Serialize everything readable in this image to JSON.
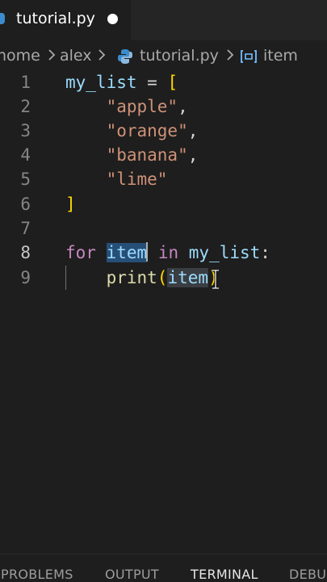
{
  "tab": {
    "filename": "tutorial.py"
  },
  "breadcrumb": {
    "items": [
      "home",
      "alex",
      "tutorial.py",
      "item"
    ]
  },
  "editor": {
    "line_numbers": [
      "1",
      "2",
      "3",
      "4",
      "5",
      "6",
      "7",
      "8",
      "9"
    ],
    "active_line": "8",
    "tokens": {
      "my_list": "my_list",
      "eq": " = ",
      "open_bracket": "[",
      "close_bracket": "]",
      "apple": "\"apple\"",
      "orange": "\"orange\"",
      "banana": "\"banana\"",
      "lime": "\"lime\"",
      "comma": ",",
      "for": "for",
      "item": "item",
      "in": "in",
      "colon": ":",
      "print": "print",
      "open_paren": "(",
      "close_paren": ")"
    }
  },
  "panel": {
    "tabs": [
      "PROBLEMS",
      "OUTPUT",
      "TERMINAL",
      "DEBU"
    ],
    "active": "TERMINAL"
  },
  "colors": {
    "background": "#1e1e1e",
    "keyword": "#c586c0",
    "variable": "#9cdcfe",
    "string": "#ce9178",
    "function": "#dcdcaa",
    "bracket": "#ffd700",
    "selection": "#264f78"
  },
  "icons": {
    "python": "python-file-icon",
    "variable": "variable-symbol-icon",
    "separator": "chevron-right-icon",
    "pointer": "text-cursor-icon"
  }
}
